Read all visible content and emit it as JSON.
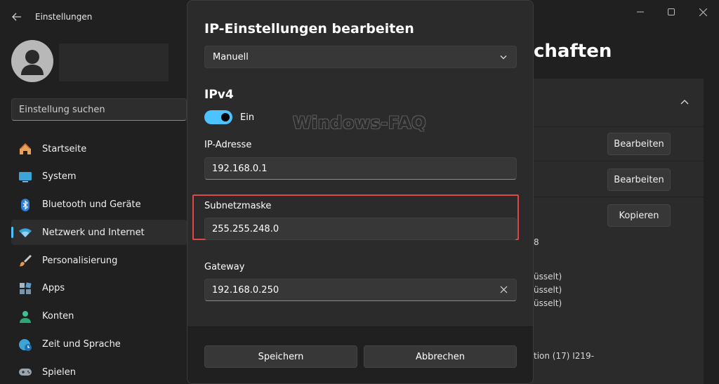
{
  "window": {
    "title": "Einstellungen"
  },
  "sidebar": {
    "search_placeholder": "Einstellung suchen",
    "items": [
      {
        "label": "Startseite",
        "icon": "home-icon"
      },
      {
        "label": "System",
        "icon": "monitor-icon"
      },
      {
        "label": "Bluetooth und Geräte",
        "icon": "bluetooth-icon"
      },
      {
        "label": "Netzwerk und Internet",
        "icon": "wifi-icon",
        "active": true
      },
      {
        "label": "Personalisierung",
        "icon": "brush-icon"
      },
      {
        "label": "Apps",
        "icon": "apps-icon"
      },
      {
        "label": "Konten",
        "icon": "person-icon"
      },
      {
        "label": "Zeit und Sprache",
        "icon": "globe-clock-icon"
      },
      {
        "label": "Spielen",
        "icon": "gamepad-icon"
      }
    ]
  },
  "background": {
    "title_fragment": "chaften",
    "buttons": {
      "edit_1": "Bearbeiten",
      "edit_2": "Bearbeiten",
      "copy": "Kopieren"
    },
    "text_fragments": {
      "f1": "8",
      "f2": "üsselt)",
      "f3": "üsselt)",
      "f4": "üsselt)",
      "f5": "tion (17) I219-"
    }
  },
  "dialog": {
    "title": "IP-Einstellungen bearbeiten",
    "mode_select": "Manuell",
    "section": "IPv4",
    "toggle": {
      "label": "Ein",
      "on": true
    },
    "watermark": "Windows-FAQ",
    "fields": {
      "ip_label": "IP-Adresse",
      "ip_value": "192.168.0.1",
      "subnet_label": "Subnetzmaske",
      "subnet_value": "255.255.248.0",
      "gateway_label": "Gateway",
      "gateway_value": "192.168.0.250"
    },
    "buttons": {
      "save": "Speichern",
      "cancel": "Abbrechen"
    }
  },
  "colors": {
    "accent": "#4cc2ff",
    "highlight": "#e04848",
    "background": "#202020",
    "dialog": "#2b2b2b"
  }
}
